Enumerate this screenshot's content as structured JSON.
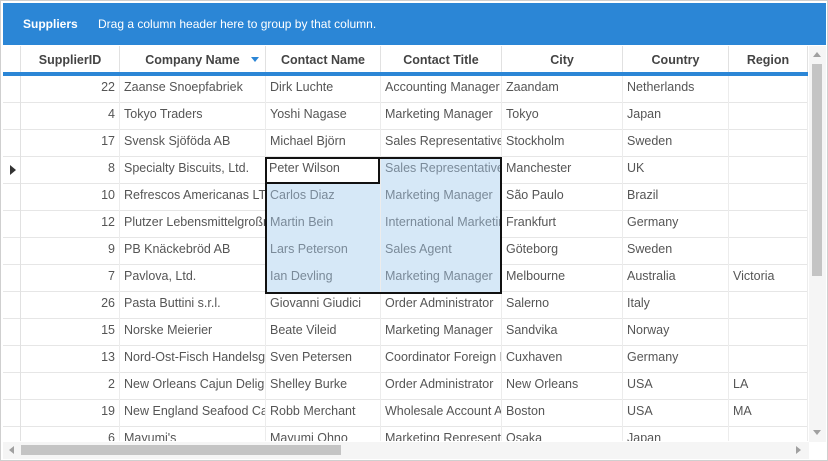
{
  "group_panel": {
    "title": "Suppliers",
    "hint": "Drag a column header here to group by that column."
  },
  "colors": {
    "accent": "#2b86d6",
    "selection": "#d6e8f7"
  },
  "columns": [
    "SupplierID",
    "Company Name",
    "Contact Name",
    "Contact Title",
    "City",
    "Country",
    "Region"
  ],
  "sorted_column": "Company Name",
  "rows": [
    [
      "22",
      "Zaanse Snoepfabriek",
      "Dirk Luchte",
      "Accounting Manager",
      "Zaandam",
      "Netherlands",
      ""
    ],
    [
      "4",
      "Tokyo Traders",
      "Yoshi Nagase",
      "Marketing Manager",
      "Tokyo",
      "Japan",
      ""
    ],
    [
      "17",
      "Svensk Sjöföda AB",
      "Michael Björn",
      "Sales Representative",
      "Stockholm",
      "Sweden",
      ""
    ],
    [
      "8",
      "Specialty Biscuits, Ltd.",
      "Peter Wilson",
      "Sales Representative",
      "Manchester",
      "UK",
      ""
    ],
    [
      "10",
      "Refrescos Americanas LTDA",
      "Carlos Diaz",
      "Marketing Manager",
      "São Paulo",
      "Brazil",
      ""
    ],
    [
      "12",
      "Plutzer Lebensmittelgroßmärkte",
      "Martin Bein",
      "International Marketing Mgr.",
      "Frankfurt",
      "Germany",
      ""
    ],
    [
      "9",
      "PB Knäckebröd AB",
      "Lars Peterson",
      "Sales Agent",
      "Göteborg",
      "Sweden",
      ""
    ],
    [
      "7",
      "Pavlova, Ltd.",
      "Ian Devling",
      "Marketing Manager",
      "Melbourne",
      "Australia",
      "Victoria"
    ],
    [
      "26",
      "Pasta Buttini s.r.l.",
      "Giovanni Giudici",
      "Order Administrator",
      "Salerno",
      "Italy",
      ""
    ],
    [
      "15",
      "Norske Meierier",
      "Beate Vileid",
      "Marketing Manager",
      "Sandvika",
      "Norway",
      ""
    ],
    [
      "13",
      "Nord-Ost-Fisch Handelsgesellschaft mbH",
      "Sven Petersen",
      "Coordinator Foreign Markets",
      "Cuxhaven",
      "Germany",
      ""
    ],
    [
      "2",
      "New Orleans Cajun Delights",
      "Shelley Burke",
      "Order Administrator",
      "New Orleans",
      "USA",
      "LA"
    ],
    [
      "19",
      "New England Seafood Cannery",
      "Robb Merchant",
      "Wholesale Account Agent",
      "Boston",
      "USA",
      "MA"
    ],
    [
      "6",
      "Mayumi's",
      "Mayumi Ohno",
      "Marketing Representative",
      "Osaka",
      "Japan",
      ""
    ]
  ],
  "current_row_index": 3
}
